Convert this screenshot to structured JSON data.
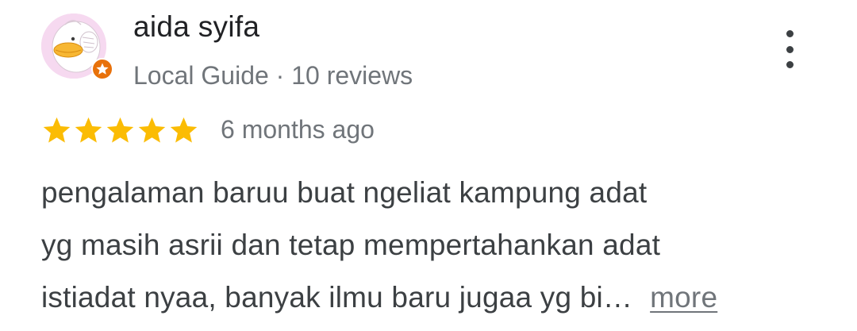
{
  "review": {
    "author": {
      "name": "aida syifa",
      "badge": "Local Guide",
      "separator": " · ",
      "reviews_count": "10 reviews",
      "badge_color": "#e8710a"
    },
    "rating": {
      "stars": 5,
      "max_stars": 5,
      "star_color": "#fbbc04"
    },
    "time_ago": "6 months ago",
    "text_lines": [
      "pengalaman baruu buat ngeliat kampung adat",
      "yg masih asrii dan tetap mempertahankan adat",
      "istiadat nyaa, banyak ilmu baru jugaa yg bi…"
    ],
    "more_label": "more",
    "menu_icon": "more-vert-icon"
  }
}
